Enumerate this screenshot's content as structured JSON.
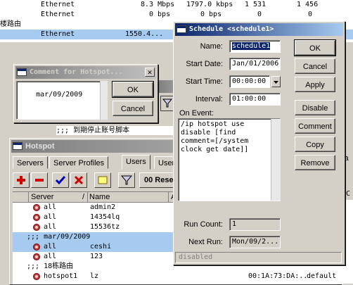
{
  "background": {
    "rows": [
      {
        "type": "Ethernet",
        "tx": "8.3 Mbps",
        "rx": "1797.0 kbps",
        "tp": "1 531",
        "rp": "1 456"
      },
      {
        "type": "Ethernet",
        "tx": "0 bps",
        "rx": "0 bps",
        "tp": "0",
        "rp": "0"
      },
      {
        "group": "楼路由"
      },
      {
        "type": "Ethernet",
        "tx": "1550.4...",
        "rx": "",
        "tp": "",
        "rp": ""
      }
    ],
    "partial_text": ";;; 到期停止账号脚本"
  },
  "comment_dialog": {
    "title": "Comment for Hotspot...",
    "text": "mar/09/2009",
    "ok_label": "OK",
    "cancel_label": "Cancel"
  },
  "schedule_dialog": {
    "title": "Schedule <schedule1>",
    "name_label": "Name:",
    "name_value": "schedule1",
    "start_date_label": "Start Date:",
    "start_date_value": "Jan/01/2006",
    "start_time_label": "Start Time:",
    "start_time_value": "00:00:00",
    "interval_label": "Interval:",
    "interval_value": "01:00:00",
    "on_event_label": "On Event:",
    "on_event_value": "/ip hotspot use\ndisable [find\ncomment=[/system\nclock get date]]",
    "run_count_label": "Run Count:",
    "run_count_value": "1",
    "next_run_label": "Next Run:",
    "next_run_value": "Mon/09/2...",
    "status_text": "disabled",
    "buttons": {
      "ok": "OK",
      "cancel": "Cancel",
      "apply": "Apply",
      "disable": "Disable",
      "comment": "Comment",
      "copy": "Copy",
      "remove": "Remove"
    }
  },
  "hotspot_window": {
    "title": "Hotspot",
    "tabs": [
      "Servers",
      "Server Profiles",
      "Users",
      "User"
    ],
    "active_tab": "Users",
    "reset_label": "00 Rese",
    "columns": {
      "server": "Server",
      "name": "Name",
      "address": "A"
    },
    "rows": [
      {
        "kind": "user",
        "server": "all",
        "name": "admin2"
      },
      {
        "kind": "user",
        "server": "all",
        "name": "14354lq"
      },
      {
        "kind": "user",
        "server": "all",
        "name": "15536tz"
      },
      {
        "kind": "comment",
        "text": ";;; mar/09/2009"
      },
      {
        "kind": "user",
        "server": "all",
        "name": "ceshi"
      },
      {
        "kind": "user",
        "server": "all",
        "name": "123"
      },
      {
        "kind": "comment",
        "text": ";;; 18栋路由"
      },
      {
        "kind": "user",
        "server": "hotspot1",
        "name": "lz",
        "mac": "00:1A:73:DA:...",
        "profile": "default"
      }
    ]
  },
  "right_panel": {
    "label_ta": "Ta",
    "row_dc": "D C"
  }
}
